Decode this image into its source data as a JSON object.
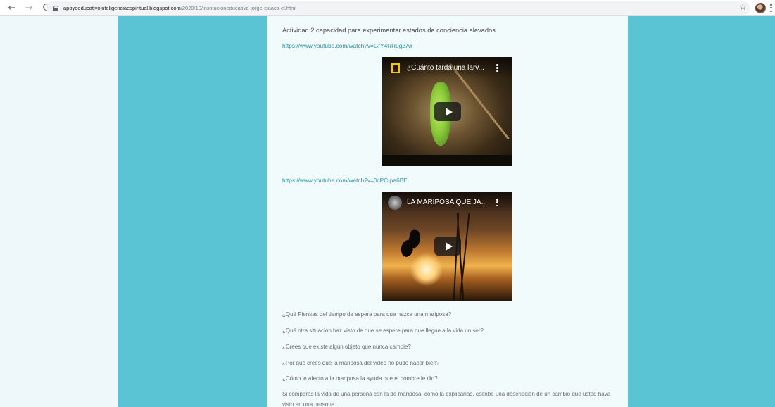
{
  "browser": {
    "url_host": "apoyoeducativointeligenciaespiritual.blogspot.com",
    "url_path": "/2020/10/institucioneducativa-jorge-isaacs-el.html",
    "back_glyph": "←",
    "forward_glyph": "→",
    "reload_glyph": "C",
    "star_glyph": "☆"
  },
  "colors": {
    "band": "#5bc4d4",
    "content_bg": "#f2fbfc",
    "link": "#2a8fa3"
  },
  "post": {
    "heading": "Actividad 2 capacidad para experimentar estados de conciencia elevados",
    "link1": "https://www.youtube.com/watch?v=GrY4RRugZAY",
    "video1_title": "¿Cuánto tarda una larv...",
    "link2": "https://www.youtube.com/watch?v=0cPC-pa6BE",
    "video2_title": "LA MARIPOSA QUE JA...",
    "questions": [
      "¿Qué Piensas del tiempo de espera para que nazca una mariposa?",
      "¿Qué otra situación haz visto de que se espere para que llegue a la vida un ser?",
      "¿Crees que existe algún objeto que nunca cambie?",
      "¿Por qué crees que la mariposa del video no pudo nacer bien?",
      "¿Cómo le afecto a la mariposa la ayuda que el hombre le dio?",
      "Si comparas la vida de una persona con la de mariposa, cómo la explicarías, escribe una descripción de un cambio que usted haya visto en una persona"
    ]
  }
}
